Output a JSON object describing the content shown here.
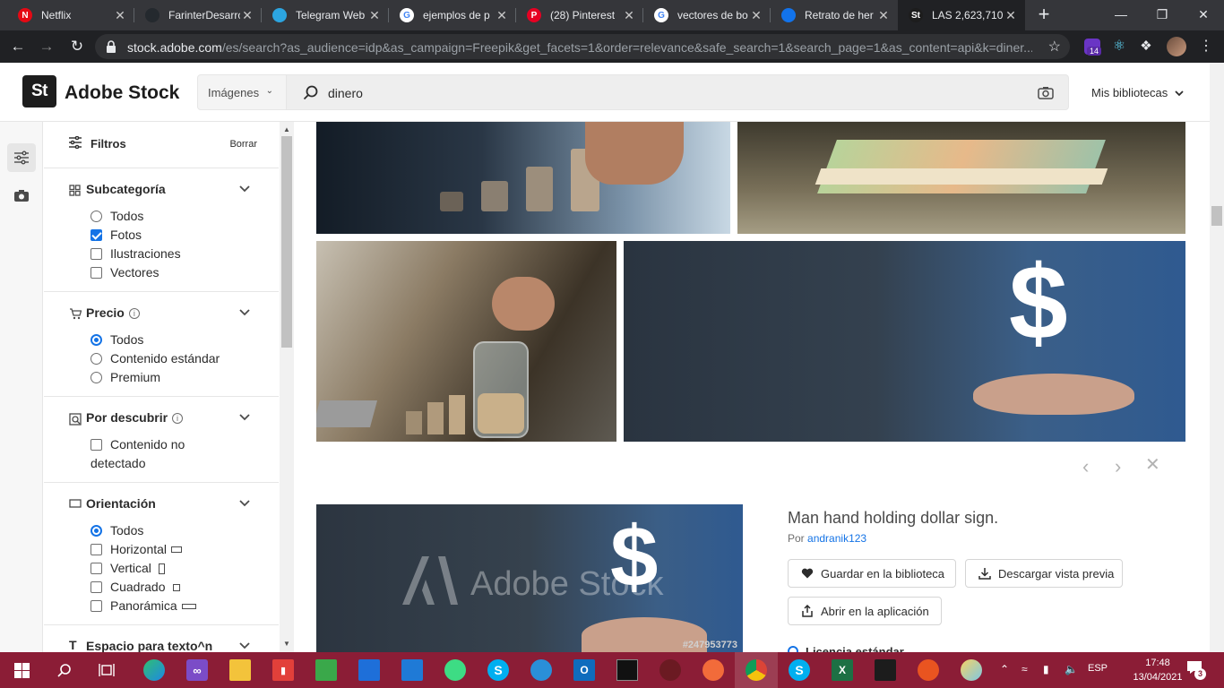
{
  "browser": {
    "tabs": [
      {
        "title": "Netflix",
        "icon": "netflix-icon",
        "color": "#e50914",
        "glyph": "N"
      },
      {
        "title": "FarinterDesarrollo",
        "icon": "github-icon",
        "color": "#24292e",
        "glyph": ""
      },
      {
        "title": "Telegram Web",
        "icon": "telegram-icon",
        "color": "#2ca5e0",
        "glyph": ""
      },
      {
        "title": "ejemplos de p",
        "icon": "google-icon",
        "color": "#ffffff",
        "glyph": "G"
      },
      {
        "title": "(28) Pinterest",
        "icon": "pinterest-icon",
        "color": "#e60023",
        "glyph": "P"
      },
      {
        "title": "vectores de bo",
        "icon": "google-icon",
        "color": "#ffffff",
        "glyph": "G"
      },
      {
        "title": "Retrato de her",
        "icon": "freepik-icon",
        "color": "#1273eb",
        "glyph": ""
      },
      {
        "title": "LAS 2,623,710",
        "icon": "adobe-stock-icon",
        "color": "#1d1d1d",
        "glyph": "St"
      }
    ],
    "url_host": "stock.adobe.com",
    "url_rest": "/es/search?as_audience=idp&as_campaign=Freepik&get_facets=1&order=relevance&safe_search=1&search_page=1&as_content=api&k=diner...",
    "extension_badge": "14"
  },
  "header": {
    "logo": "St",
    "brand": "Adobe Stock",
    "type_select": "Imágenes",
    "search_value": "dinero",
    "libraries": "Mis bibliotecas"
  },
  "filters": {
    "title": "Filtros",
    "clear": "Borrar",
    "subcategory": {
      "title": "Subcategoría",
      "options": [
        {
          "label": "Todos",
          "kind": "radio",
          "checked": false
        },
        {
          "label": "Fotos",
          "kind": "checkbox",
          "checked": true
        },
        {
          "label": "Ilustraciones",
          "kind": "checkbox",
          "checked": false
        },
        {
          "label": "Vectores",
          "kind": "checkbox",
          "checked": false
        }
      ]
    },
    "price": {
      "title": "Precio",
      "options": [
        {
          "label": "Todos",
          "kind": "radio",
          "checked": true
        },
        {
          "label": "Contenido estándar",
          "kind": "radio",
          "checked": false
        },
        {
          "label": "Premium",
          "kind": "radio",
          "checked": false
        }
      ]
    },
    "discover": {
      "title": "Por descubrir",
      "options": [
        {
          "label": "Contenido no",
          "label2": "detectado",
          "kind": "checkbox",
          "checked": false
        }
      ]
    },
    "orientation": {
      "title": "Orientación",
      "options": [
        {
          "label": "Todos",
          "kind": "radio",
          "checked": true
        },
        {
          "label": "Horizontal",
          "kind": "checkbox",
          "checked": false
        },
        {
          "label": "Vertical",
          "kind": "checkbox",
          "checked": false
        },
        {
          "label": "Cuadrado",
          "kind": "checkbox",
          "checked": false
        },
        {
          "label": "Panorámica",
          "kind": "checkbox",
          "checked": false
        }
      ]
    },
    "copyspace": {
      "title": "Espacio para texto^n"
    }
  },
  "detail": {
    "title": "Man hand holding dollar sign.",
    "by": "Por",
    "author": "andranik123",
    "save": "Guardar en la biblioteca",
    "download": "Descargar vista previa",
    "open": "Abrir en la aplicación",
    "license": "Licencia estándar",
    "watermark": "Adobe Stock",
    "image_id": "#247953773"
  },
  "taskbar": {
    "lang": "ESP",
    "time": "17:48",
    "date": "13/04/2021",
    "notifications": "3"
  },
  "colors": {
    "accent": "#1473e6",
    "taskbar": "#8b1d36"
  }
}
